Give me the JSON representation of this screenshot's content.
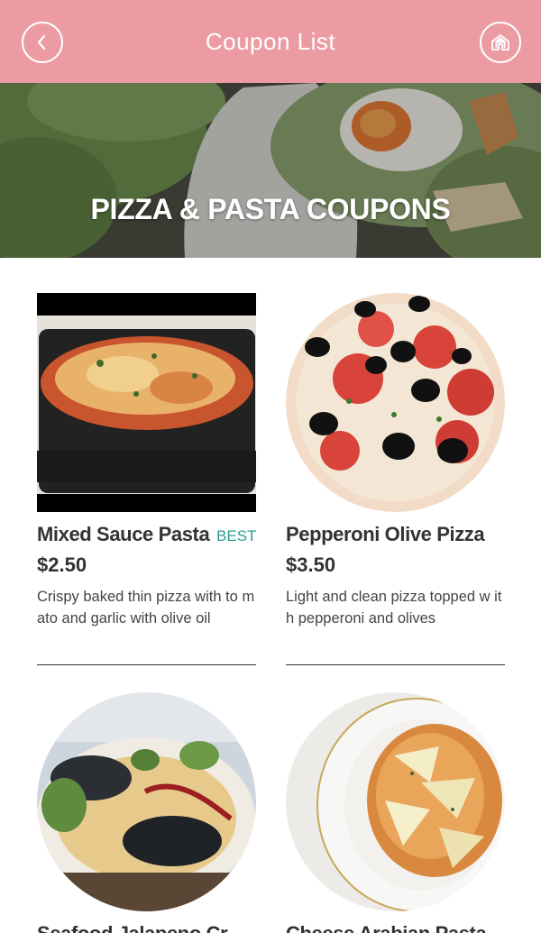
{
  "header": {
    "title": "Coupon List",
    "back_icon": "chevron-left-icon",
    "home_icon": "home-icon"
  },
  "hero": {
    "title": "PIZZA & PASTA COUPONS"
  },
  "colors": {
    "brand": "#ec9ba3",
    "badge": "#2a9d8f",
    "text": "#333333"
  },
  "coupons": [
    {
      "name": "Mixed Sauce Pasta",
      "badge": "BEST",
      "price": "$2.50",
      "description": "Crispy baked thin pizza with to mato and garlic with olive oil"
    },
    {
      "name": "Pepperoni Olive Pizza",
      "badge": "",
      "price": "$3.50",
      "description": "Light and clean pizza topped w ith pepperoni and olives"
    },
    {
      "name": "Seafood Jalapeno Cr...",
      "badge": "",
      "price": "",
      "description": ""
    },
    {
      "name": "Cheese Arabian Pasta",
      "badge": "",
      "price": "",
      "description": ""
    }
  ]
}
